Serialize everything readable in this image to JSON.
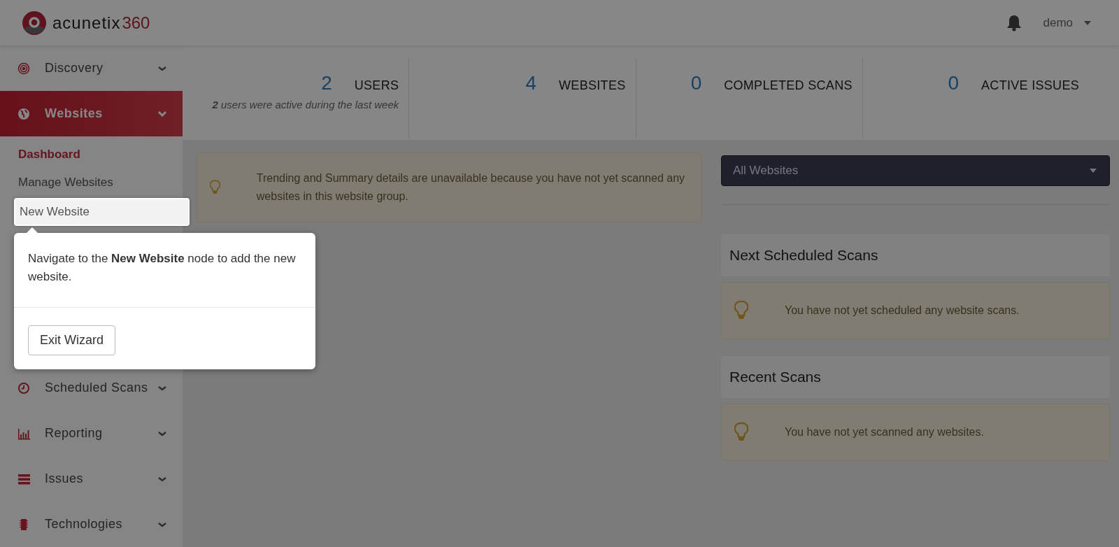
{
  "header": {
    "logo": {
      "name": "acunetix",
      "suffix": "360"
    },
    "user": "demo"
  },
  "sidebar": {
    "items": [
      {
        "label": "Discovery",
        "selected": false,
        "expanded": false
      },
      {
        "label": "Websites",
        "selected": true,
        "expanded": true,
        "children": [
          {
            "label": "Dashboard",
            "selected": true,
            "highlighted": false
          },
          {
            "label": "Manage Websites",
            "selected": false,
            "highlighted": false
          },
          {
            "label": "New Website",
            "selected": false,
            "highlighted": true
          }
        ]
      },
      {
        "label": "Scheduled Scans",
        "selected": false,
        "expanded": false
      },
      {
        "label": "Reporting",
        "selected": false,
        "expanded": false
      },
      {
        "label": "Issues",
        "selected": false,
        "expanded": false
      },
      {
        "label": "Technologies",
        "selected": false,
        "expanded": false
      }
    ]
  },
  "stats": [
    {
      "value": "2",
      "label": "USERS",
      "note": "**2** users were active during the last week"
    },
    {
      "value": "4",
      "label": "WEBSITES"
    },
    {
      "value": "0",
      "label": "COMPLETED SCANS"
    },
    {
      "value": "0",
      "label": "ACTIVE ISSUES"
    }
  ],
  "trend_alert": "Trending and Summary details are unavailable because you have not yet scanned any websites in this website group.",
  "website_select": {
    "value": "All Websites"
  },
  "panels": [
    {
      "title": "Next Scheduled Scans",
      "message": "You have not yet scheduled any website scans."
    },
    {
      "title": "Recent Scans",
      "message": "You have not yet scanned any websites."
    }
  ],
  "wizard": {
    "message": "Navigate to the **New Website** node to add the new website.",
    "button": "Exit Wizard"
  }
}
